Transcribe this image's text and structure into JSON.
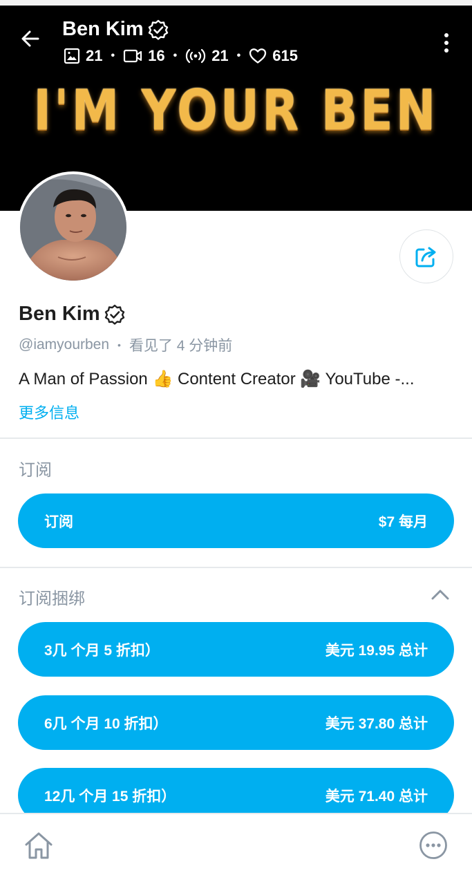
{
  "header": {
    "name": "Ben Kim",
    "stats": {
      "photos": "21",
      "videos": "16",
      "streams": "21",
      "likes": "615"
    }
  },
  "cover": {
    "banner_text": "I'M YOUR BEN"
  },
  "profile": {
    "name": "Ben Kim",
    "handle": "@iamyourben",
    "last_seen": "看见了  4 分钟前",
    "bio": "A Man of Passion 👍 Content Creator 🎥 YouTube -...",
    "more_info": "更多信息"
  },
  "subscription": {
    "section_title": "订阅",
    "button_label": "订阅",
    "button_price": "$7 每月"
  },
  "bundles": {
    "section_title": "订阅捆绑",
    "items": [
      {
        "label": "3几 个月 5 折扣）",
        "price": "美元 19.95 总计"
      },
      {
        "label": "6几 个月 10 折扣）",
        "price": "美元 37.80 总计"
      },
      {
        "label": "12几 个月 15 折扣）",
        "price": "美元 71.40 总计"
      }
    ]
  },
  "colors": {
    "accent": "#00aff0",
    "muted": "#8a96a3",
    "cover": "#000000"
  },
  "icons": [
    "back-arrow-icon",
    "verified-icon",
    "image-icon",
    "video-icon",
    "broadcast-icon",
    "heart-icon",
    "more-vertical-icon",
    "share-icon",
    "chevron-up-icon",
    "home-icon",
    "more-horizontal-icon"
  ]
}
